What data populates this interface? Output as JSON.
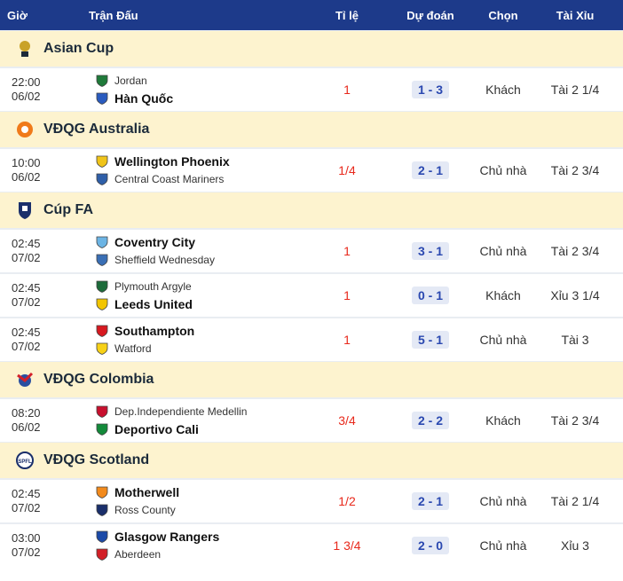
{
  "headers": {
    "time": "Giờ",
    "match": "Trận Đấu",
    "odds": "Tỉ lệ",
    "prediction": "Dự đoán",
    "pick": "Chọn",
    "over_under": "Tài Xỉu"
  },
  "leagues": [
    {
      "name": "Asian Cup",
      "logo": "asian-cup-logo",
      "matches": [
        {
          "time": "22:00",
          "date": "06/02",
          "home": "Jordan",
          "away": "Hàn Quốc",
          "strong": "away",
          "odds": "1",
          "prediction": "1 - 3",
          "pick": "Khách",
          "ou": "Tài 2 1/4",
          "home_color": "#1f7a3a",
          "away_color": "#2a5bbf"
        }
      ]
    },
    {
      "name": "VĐQG Australia",
      "logo": "a-league-logo",
      "matches": [
        {
          "time": "10:00",
          "date": "06/02",
          "home": "Wellington Phoenix",
          "away": "Central Coast Mariners",
          "strong": "home",
          "odds": "1/4",
          "prediction": "2 - 1",
          "pick": "Chủ nhà",
          "ou": "Tài 2 3/4",
          "home_color": "#f0c419",
          "away_color": "#2f5fa8"
        }
      ]
    },
    {
      "name": "Cúp FA",
      "logo": "fa-cup-logo",
      "matches": [
        {
          "time": "02:45",
          "date": "07/02",
          "home": "Coventry City",
          "away": "Sheffield Wednesday",
          "strong": "home",
          "odds": "1",
          "prediction": "3 - 1",
          "pick": "Chủ nhà",
          "ou": "Tài 2 3/4",
          "home_color": "#6cb4e4",
          "away_color": "#3a6fb5"
        },
        {
          "time": "02:45",
          "date": "07/02",
          "home": "Plymouth Argyle",
          "away": "Leeds United",
          "strong": "away",
          "odds": "1",
          "prediction": "0 - 1",
          "pick": "Khách",
          "ou": "Xỉu 3 1/4",
          "home_color": "#1d6b3a",
          "away_color": "#f2c500"
        },
        {
          "time": "02:45",
          "date": "07/02",
          "home": "Southampton",
          "away": "Watford",
          "strong": "home",
          "odds": "1",
          "prediction": "5 - 1",
          "pick": "Chủ nhà",
          "ou": "Tài 3",
          "home_color": "#d71920",
          "away_color": "#f7d117"
        }
      ]
    },
    {
      "name": "VĐQG Colombia",
      "logo": "colombia-league-logo",
      "matches": [
        {
          "time": "08:20",
          "date": "06/02",
          "home": "Dep.Independiente Medellin",
          "away": "Deportivo Cali",
          "strong": "away",
          "odds": "3/4",
          "prediction": "2 - 2",
          "pick": "Khách",
          "ou": "Tài 2 3/4",
          "home_color": "#c8102e",
          "away_color": "#138a3a"
        }
      ]
    },
    {
      "name": "VĐQG Scotland",
      "logo": "spfl-logo",
      "matches": [
        {
          "time": "02:45",
          "date": "07/02",
          "home": "Motherwell",
          "away": "Ross County",
          "strong": "home",
          "odds": "1/2",
          "prediction": "2 - 1",
          "pick": "Chủ nhà",
          "ou": "Tài 2 1/4",
          "home_color": "#f28a1c",
          "away_color": "#1a2f6b"
        },
        {
          "time": "03:00",
          "date": "07/02",
          "home": "Glasgow Rangers",
          "away": "Aberdeen",
          "strong": "home",
          "odds": "1 3/4",
          "prediction": "2 - 0",
          "pick": "Chủ nhà",
          "ou": "Xỉu 3",
          "home_color": "#1b4aa8",
          "away_color": "#d21f26"
        }
      ]
    }
  ]
}
